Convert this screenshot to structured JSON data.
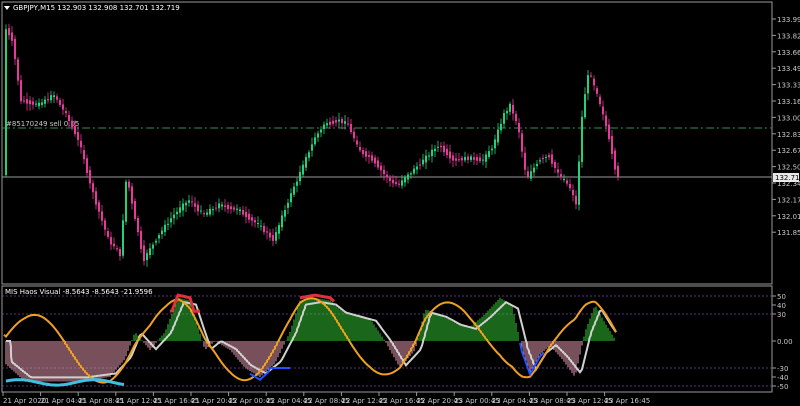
{
  "main_chart": {
    "title": "GBPJPY,M15  132.903 132.908 132.701 132.719",
    "order_label": "#85170249 sell 0.05",
    "current_price": "132.719",
    "price_ticks": [
      "133.990",
      "133.825",
      "133.660",
      "133.495",
      "133.330",
      "133.165",
      "133.000",
      "132.835",
      "132.670",
      "132.505",
      "132.340",
      "132.175",
      "132.010",
      "131.850"
    ],
    "colors": {
      "bull": "#22d27a",
      "bear": "#e6399b",
      "grid": "#3a3a3a",
      "order_line": "#2f8f4f",
      "price_line": "#9a9a9a"
    }
  },
  "indicator": {
    "title": "MIS Haos Visual -8.5643 -8.5643 -21.9596",
    "level_ticks": [
      "50",
      "40",
      "30",
      "0.00",
      "-30",
      "-40",
      "-50"
    ],
    "colors": {
      "pos_hist": "#33cc33",
      "neg_hist": "#f0a0b8",
      "orange": "#f0a020",
      "white": "#d0d0d0",
      "blue": "#2050ff",
      "cyan": "#40c0e0",
      "red": "#e03040"
    }
  },
  "time_axis": [
    "21 Apr 2020",
    "21 Apr 04:45",
    "21 Apr 08:45",
    "21 Apr 12:45",
    "21 Apr 16:45",
    "21 Apr 20:45",
    "22 Apr 00:45",
    "22 Apr 04:45",
    "22 Apr 08:45",
    "22 Apr 12:45",
    "22 Apr 16:45",
    "22 Apr 20:45",
    "23 Apr 00:45",
    "23 Apr 04:45",
    "23 Apr 08:45",
    "23 Apr 12:45",
    "23 Apr 16:45"
  ]
}
